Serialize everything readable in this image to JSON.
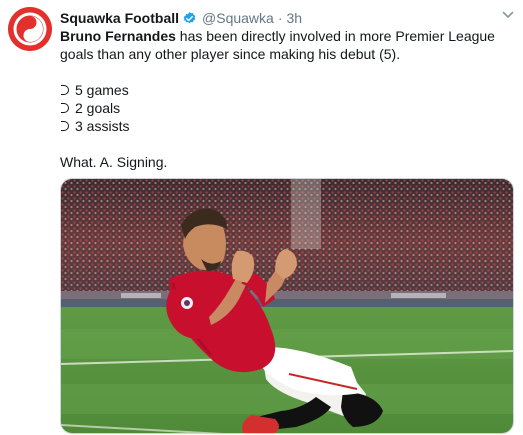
{
  "account": {
    "display_name": "Squawka Football",
    "handle": "@Squawka",
    "separator": "·",
    "time": "3h"
  },
  "tweet": {
    "lead_bold": "Bruno Fernandes",
    "lead_rest": " has been directly involved in more Premier League goals than any other player since making his debut (5).",
    "bullets": [
      "5 games",
      "2 goals",
      "3 assists"
    ],
    "closing": "What. A. Signing."
  },
  "colors": {
    "brand_red": "#e2302c",
    "verified_blue": "#1da1f2",
    "muted_text": "#657786"
  },
  "icons": {
    "avatar": "squawka-logo",
    "verified": "verified-badge-icon",
    "menu": "chevron-down-icon"
  }
}
